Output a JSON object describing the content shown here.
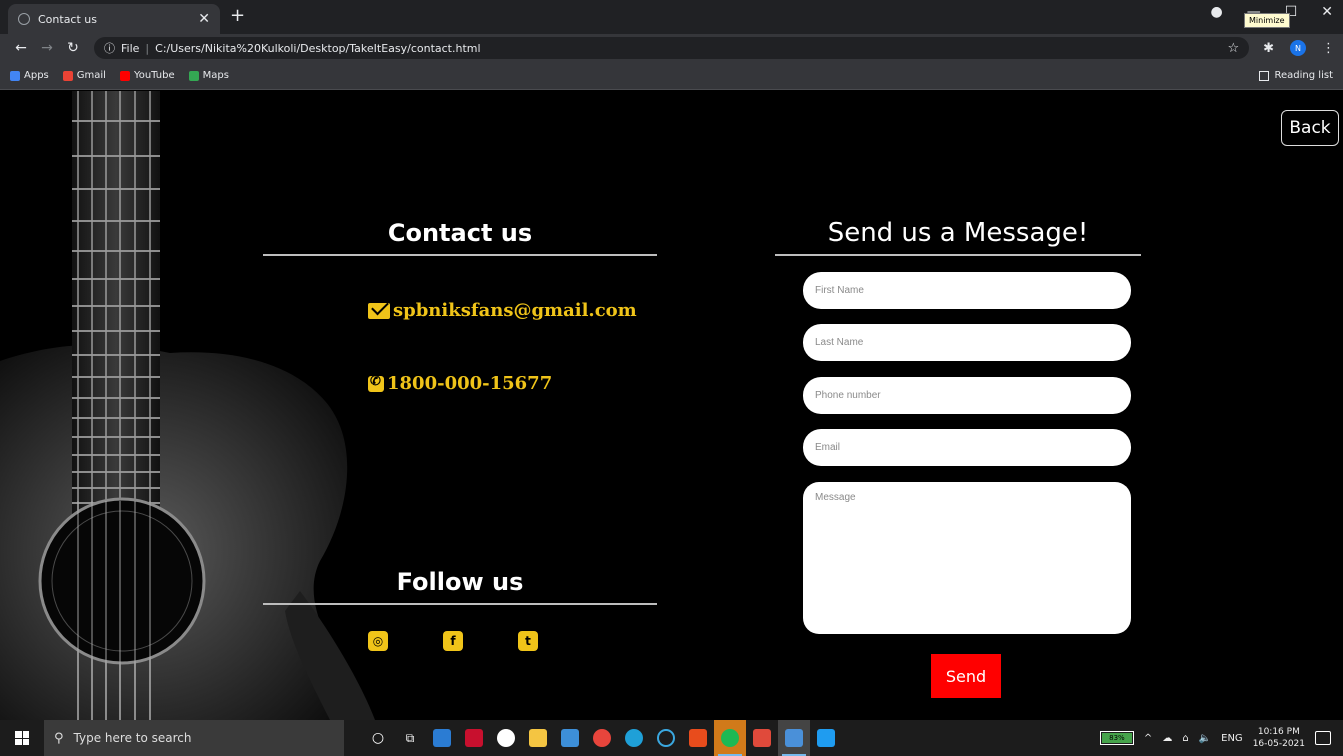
{
  "browser": {
    "tab_title": "Contact us",
    "tab_close": "✕",
    "new_tab": "+",
    "tooltip": "Minimize",
    "address_prefix": "File",
    "address": "C:/Users/Nikita%20Kulkoli/Desktop/TakeItEasy/contact.html",
    "profile_initial": "N",
    "bookmarks": [
      {
        "label": "Apps",
        "color": "#4285f4"
      },
      {
        "label": "Gmail",
        "color": "#ea4335"
      },
      {
        "label": "YouTube",
        "color": "#ff0000"
      },
      {
        "label": "Maps",
        "color": "#34a853"
      }
    ],
    "reading_list": "Reading list"
  },
  "page": {
    "back_label": "Back",
    "contact_title": "Contact us",
    "email": "spbniksfans@gmail.com",
    "phone": "1800-000-15677",
    "follow_title": "Follow us",
    "social": [
      {
        "name": "instagram",
        "glyph": "◎"
      },
      {
        "name": "facebook",
        "glyph": "f"
      },
      {
        "name": "twitter",
        "glyph": "t"
      }
    ],
    "accent_color": "#f0c419",
    "send_title": "Send us a Message!",
    "form": {
      "first_name_placeholder": "First Name",
      "last_name_placeholder": "Last Name",
      "phone_placeholder": "Phone number",
      "email_placeholder": "Email",
      "message_placeholder": "Message",
      "send_label": "Send"
    }
  },
  "taskbar": {
    "search_placeholder": "Type here to search",
    "battery": "83%",
    "language": "ENG",
    "time": "10:16 PM",
    "date": "16-05-2021"
  }
}
